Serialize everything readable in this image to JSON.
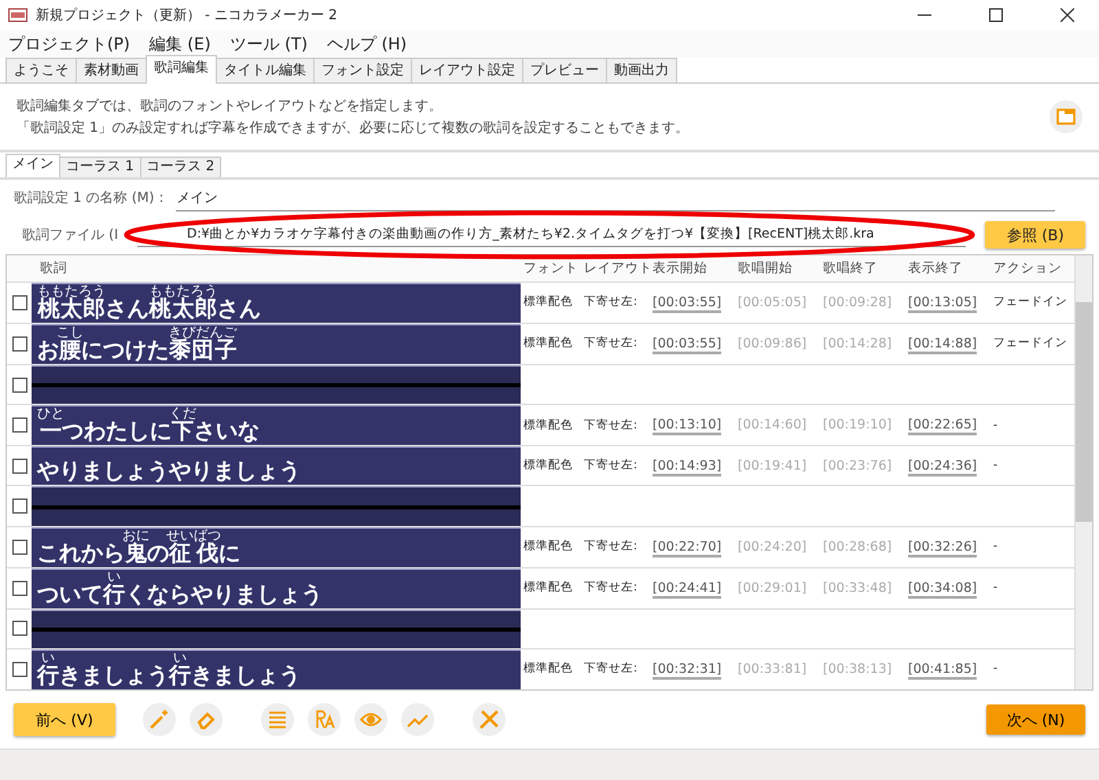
{
  "window": {
    "title": "新規プロジェクト（更新） - ニコカラメーカー 2"
  },
  "menu": [
    "プロジェクト(P)",
    "編集 (E)",
    "ツール (T)",
    "ヘルプ (H)"
  ],
  "tabs": [
    {
      "label": "ようこそ",
      "selected": false
    },
    {
      "label": "素材動画",
      "selected": false
    },
    {
      "label": "歌詞編集",
      "selected": true
    },
    {
      "label": "タイトル編集",
      "selected": false
    },
    {
      "label": "フォント設定",
      "selected": false
    },
    {
      "label": "レイアウト設定",
      "selected": false
    },
    {
      "label": "プレビュー",
      "selected": false
    },
    {
      "label": "動画出力",
      "selected": false
    }
  ],
  "description": [
    "歌詞編集タブでは、歌詞のフォントやレイアウトなどを指定します。",
    "「歌詞設定 1」のみ設定すれば字幕を作成できますが、必要に応じて複数の歌詞を設定することもできます。"
  ],
  "sub_tabs": [
    {
      "label": "メイン",
      "selected": true
    },
    {
      "label": "コーラス 1",
      "selected": false
    },
    {
      "label": "コーラス 2",
      "selected": false
    }
  ],
  "name_field": {
    "label": "歌詞設定 1 の名称 (M)：",
    "value": "メイン"
  },
  "file_field": {
    "label": "歌詞ファイル (I",
    "value": "D:¥曲とか¥カラオケ字幕付きの楽曲動画の作り方_素材たち¥2.タイムタグを打つ¥【変換】[RecENT]桃太郎.kra"
  },
  "browse_button": "参照 (B)",
  "table": {
    "columns": [
      "歌詞",
      "フォント",
      "レイアウト",
      "表示開始",
      "歌唱開始",
      "歌唱終了",
      "表示終了",
      "アクション"
    ],
    "rows": [
      {
        "kind": "lyric",
        "checked": false,
        "lyric": [
          {
            "text": "桃太郎",
            "ruby": "ももたろう"
          },
          {
            "text": "さん"
          },
          {
            "text": "桃太郎",
            "ruby": "ももたろう"
          },
          {
            "text": "さん"
          }
        ],
        "cells": [
          "標準配色",
          "下寄せ左:",
          "[00:03:55]",
          "[00:05:05]",
          "[00:09:28]",
          "[00:13:05]",
          "フェードイン"
        ]
      },
      {
        "kind": "lyric",
        "checked": false,
        "lyric": [
          {
            "text": "お"
          },
          {
            "text": "腰",
            "ruby": "こし"
          },
          {
            "text": "につけた"
          },
          {
            "text": "黍団子",
            "ruby": "きびだんご"
          }
        ],
        "cells": [
          "標準配色",
          "下寄せ左:",
          "[00:03:55]",
          "[00:09:86]",
          "[00:14:28]",
          "[00:14:88]",
          "フェードイン"
        ]
      },
      {
        "kind": "blank",
        "checked": false
      },
      {
        "kind": "lyric",
        "checked": false,
        "lyric": [
          {
            "text": "一",
            "ruby": "ひと"
          },
          {
            "text": "つわたしに"
          },
          {
            "text": "下",
            "ruby": "くだ"
          },
          {
            "text": "さいな"
          }
        ],
        "cells": [
          "標準配色",
          "下寄せ左:",
          "[00:13:10]",
          "[00:14:60]",
          "[00:19:10]",
          "[00:22:65]",
          "-"
        ]
      },
      {
        "kind": "lyric",
        "checked": false,
        "lyric": [
          {
            "text": "やりましょうやりましょう"
          }
        ],
        "cells": [
          "標準配色",
          "下寄せ左:",
          "[00:14:93]",
          "[00:19:41]",
          "[00:23:76]",
          "[00:24:36]",
          "-"
        ]
      },
      {
        "kind": "blank",
        "checked": false
      },
      {
        "kind": "lyric",
        "checked": false,
        "lyric": [
          {
            "text": "これから"
          },
          {
            "text": "鬼",
            "ruby": "おに"
          },
          {
            "text": "の"
          },
          {
            "text": "征伐",
            "ruby": "せいばつ"
          },
          {
            "text": "に"
          }
        ],
        "cells": [
          "標準配色",
          "下寄せ左:",
          "[00:22:70]",
          "[00:24:20]",
          "[00:28:68]",
          "[00:32:26]",
          "-"
        ]
      },
      {
        "kind": "lyric",
        "checked": false,
        "lyric": [
          {
            "text": "ついて"
          },
          {
            "text": "行",
            "ruby": "い"
          },
          {
            "text": "くならやりましょう"
          }
        ],
        "cells": [
          "標準配色",
          "下寄せ左:",
          "[00:24:41]",
          "[00:29:01]",
          "[00:33:48]",
          "[00:34:08]",
          "-"
        ]
      },
      {
        "kind": "blank",
        "checked": false
      },
      {
        "kind": "lyric",
        "checked": false,
        "lyric": [
          {
            "text": "行",
            "ruby": "い"
          },
          {
            "text": "きましょう"
          },
          {
            "text": "行",
            "ruby": "い"
          },
          {
            "text": "きましょう"
          }
        ],
        "cells": [
          "標準配色",
          "下寄せ左:",
          "[00:32:31]",
          "[00:33:81]",
          "[00:38:13]",
          "[00:41:85]",
          "-"
        ]
      }
    ]
  },
  "footer": {
    "prev_button": "前へ (V)",
    "next_button": "次へ (N)"
  }
}
